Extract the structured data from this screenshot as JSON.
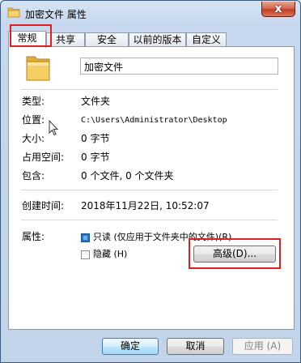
{
  "window": {
    "title": "加密文件 属性",
    "close_glyph": "x"
  },
  "tabs": [
    {
      "label": "常规",
      "active": true
    },
    {
      "label": "共享",
      "active": false
    },
    {
      "label": "安全",
      "active": false
    },
    {
      "label": "以前的版本",
      "active": false
    },
    {
      "label": "自定义",
      "active": false
    }
  ],
  "general": {
    "folder_name": "加密文件",
    "type_label": "类型:",
    "type_value": "文件夹",
    "location_label": "位置:",
    "location_value": "C:\\Users\\Administrator\\Desktop",
    "size_label": "大小:",
    "size_value": "0 字节",
    "size_on_disk_label": "占用空间:",
    "size_on_disk_value": "0 字节",
    "contains_label": "包含:",
    "contains_value": "0 个文件, 0 个文件夹",
    "created_label": "创建时间:",
    "created_value": "2018年11月22日, 10:52:07",
    "attributes_label": "属性:",
    "readonly_label": "只读 (仅应用于文件夹中的文件)(R)",
    "readonly_state": "indeterminate",
    "hidden_label": "隐藏 (H)",
    "hidden_checked": false,
    "advanced_button": "高级(D)..."
  },
  "footer": {
    "ok": "确定",
    "cancel": "取消",
    "apply": "应用 (A)",
    "apply_enabled": false
  },
  "icons": {
    "title": "folder-icon",
    "large": "folder-icon",
    "close": "close-icon",
    "cursor": "mouse-cursor-icon"
  },
  "colors": {
    "highlight_box": "#e02020",
    "folder_yellow": "#f2c94c",
    "checkbox_fill": "#2c74bf"
  }
}
